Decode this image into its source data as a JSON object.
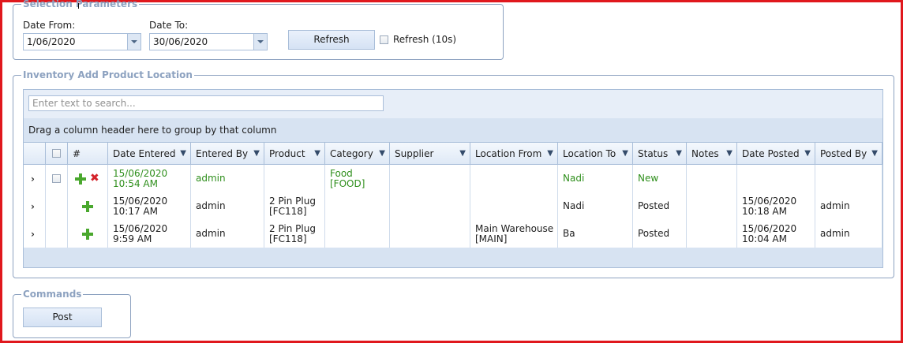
{
  "selection": {
    "legend": "Selection Parameters",
    "date_from_label": "Date From:",
    "date_from_value": "1/06/2020",
    "date_to_label": "Date To:",
    "date_to_value": "30/06/2020",
    "refresh_label": "Refresh",
    "auto_refresh_label": "Refresh (10s)"
  },
  "inventory": {
    "legend": "Inventory Add Product Location",
    "search_placeholder": "Enter text to search...",
    "group_hint": "Drag a column header here to group by that column",
    "columns": [
      "#",
      "Date Entered",
      "Entered By",
      "Product",
      "Category",
      "Supplier",
      "Location From",
      "Location To",
      "Status",
      "Notes",
      "Date Posted",
      "Posted By"
    ],
    "rows": [
      {
        "date_entered": [
          "15/06/2020",
          "10:54 AM"
        ],
        "entered_by": "admin",
        "product": [
          "",
          ""
        ],
        "category": [
          "Food",
          "[FOOD]"
        ],
        "supplier": "",
        "location_from": [
          "",
          ""
        ],
        "location_to": "Nadi",
        "status": "New",
        "notes": "",
        "date_posted": [
          "",
          ""
        ],
        "posted_by": ""
      },
      {
        "date_entered": [
          "15/06/2020",
          "10:17 AM"
        ],
        "entered_by": "admin",
        "product": [
          "2 Pin Plug",
          "[FC118]"
        ],
        "category": [
          "",
          ""
        ],
        "supplier": "",
        "location_from": [
          "",
          ""
        ],
        "location_to": "Nadi",
        "status": "Posted",
        "notes": "",
        "date_posted": [
          "15/06/2020",
          "10:18 AM"
        ],
        "posted_by": "admin"
      },
      {
        "date_entered": [
          "15/06/2020",
          "9:59 AM"
        ],
        "entered_by": "admin",
        "product": [
          "2 Pin Plug",
          "[FC118]"
        ],
        "category": [
          "",
          ""
        ],
        "supplier": "",
        "location_from": [
          "Main Warehouse",
          "[MAIN]"
        ],
        "location_to": "Ba",
        "status": "Posted",
        "notes": "",
        "date_posted": [
          "15/06/2020",
          "10:04 AM"
        ],
        "posted_by": "admin"
      }
    ]
  },
  "commands": {
    "legend": "Commands",
    "post_label": "Post"
  },
  "icons": {
    "expand": "chevron-right-icon",
    "filter": "filter-icon",
    "add": "plus-icon",
    "delete": "delete-icon"
  },
  "colors": {
    "frame": "#e0181d",
    "accent": "#8da2c0",
    "new_row_text": "#2f8f1c"
  }
}
